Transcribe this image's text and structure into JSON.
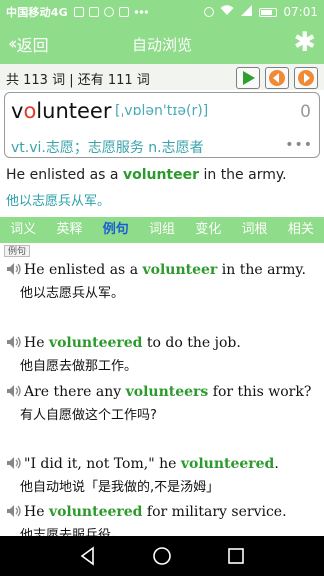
{
  "status": {
    "carrier": "中国移动4G",
    "network": "4G",
    "time": "07:01"
  },
  "titlebar": {
    "back_label": "返回",
    "title": "自动浏览"
  },
  "counts": {
    "total": "共 113 词 | 还有 111 词"
  },
  "word": {
    "pre": "v",
    "highlight": "o",
    "post": "lunteer",
    "phonetic": "[ˌvɒlən'tɪə(r)]",
    "count": "0",
    "meaning": "vt.vi.志愿；志愿服务 n.志愿者"
  },
  "highlight_sentence": {
    "pre": "He enlisted as a ",
    "word": "volunteer",
    "post": " in the army.",
    "translation": "他以志愿兵从军。"
  },
  "tabs": [
    "词义",
    "英释",
    "例句",
    "词组",
    "变化",
    "词根",
    "相关"
  ],
  "examples_label": "例句",
  "examples": [
    {
      "pre": "He enlisted as a ",
      "word": "volunteer",
      "post": " in the army.",
      "cn": "他以志愿兵从军。"
    },
    {
      "pre": "He ",
      "word": "volunteered",
      "post": " to do the job.",
      "cn": "他自愿去做那工作。"
    },
    {
      "pre": "Are there any ",
      "word": "volunteers",
      "post": " for this work?",
      "cn": "有人自愿做这个工作吗?"
    },
    {
      "pre": "\"I did it, not Tom,\" he ",
      "word": "volunteered",
      "post": ".",
      "cn": "他自动地说「是我做的,不是汤姆」"
    },
    {
      "pre": "He ",
      "word": "volunteered",
      "post": " for military service.",
      "cn": "他志愿去服兵役。"
    }
  ],
  "colors": {
    "bar": "#8fdc8b",
    "active_tab": "#1a5fd1",
    "keyword": "#2c9a2c",
    "phonetic": "#4aa9b6"
  },
  "icons": [
    "back-chevron-icon",
    "star-icon",
    "play-icon",
    "previous-icon",
    "next-icon",
    "speaker-icon",
    "more-icon"
  ]
}
